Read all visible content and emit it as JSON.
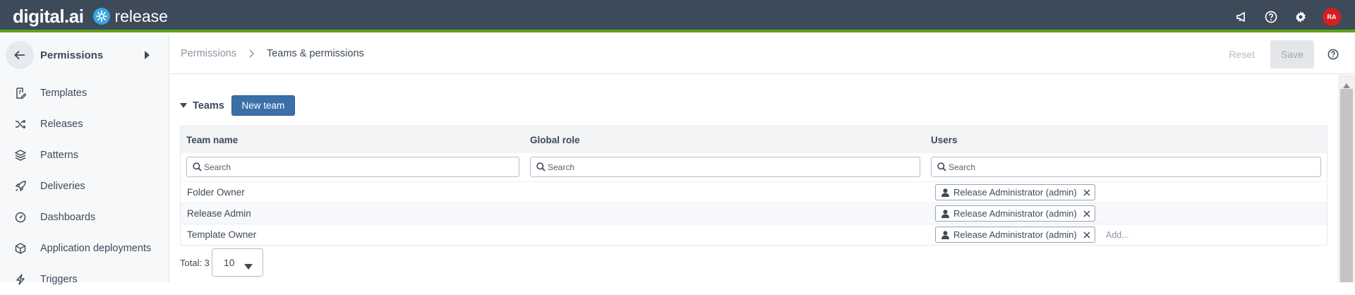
{
  "brand": {
    "company": "digital.ai",
    "product": "release"
  },
  "topbar": {
    "icons": [
      "megaphone-icon",
      "help-icon",
      "gear-icon"
    ],
    "avatar_initials": "RA",
    "avatar_color": "#d61f21"
  },
  "sidebar": {
    "title": "Permissions",
    "items": [
      {
        "label": "Templates",
        "icon": "template-icon"
      },
      {
        "label": "Releases",
        "icon": "shuffle-icon"
      },
      {
        "label": "Patterns",
        "icon": "layers-icon"
      },
      {
        "label": "Deliveries",
        "icon": "rocket-icon"
      },
      {
        "label": "Dashboards",
        "icon": "gauge-icon"
      },
      {
        "label": "Application deployments",
        "icon": "cube-icon"
      },
      {
        "label": "Triggers",
        "icon": "bolt-icon"
      }
    ]
  },
  "header": {
    "breadcrumb": {
      "parent": "Permissions",
      "current": "Teams & permissions"
    },
    "reset_label": "Reset",
    "save_label": "Save"
  },
  "teams": {
    "section_label": "Teams",
    "new_team_label": "New team",
    "columns": [
      "Team name",
      "Global role",
      "Users"
    ],
    "search_placeholder": "Search",
    "rows": [
      {
        "name": "Folder Owner",
        "role": "",
        "user": "Release Administrator (admin)",
        "add": ""
      },
      {
        "name": "Release Admin",
        "role": "",
        "user": "Release Administrator (admin)",
        "add": ""
      },
      {
        "name": "Template Owner",
        "role": "",
        "user": "Release Administrator (admin)",
        "add": "Add..."
      }
    ],
    "total_label": "Total: 3",
    "page_size": "10"
  },
  "colors": {
    "topbar": "#3d4a5a",
    "accent_green": "#5da418",
    "primary_button": "#3b6fa8"
  }
}
